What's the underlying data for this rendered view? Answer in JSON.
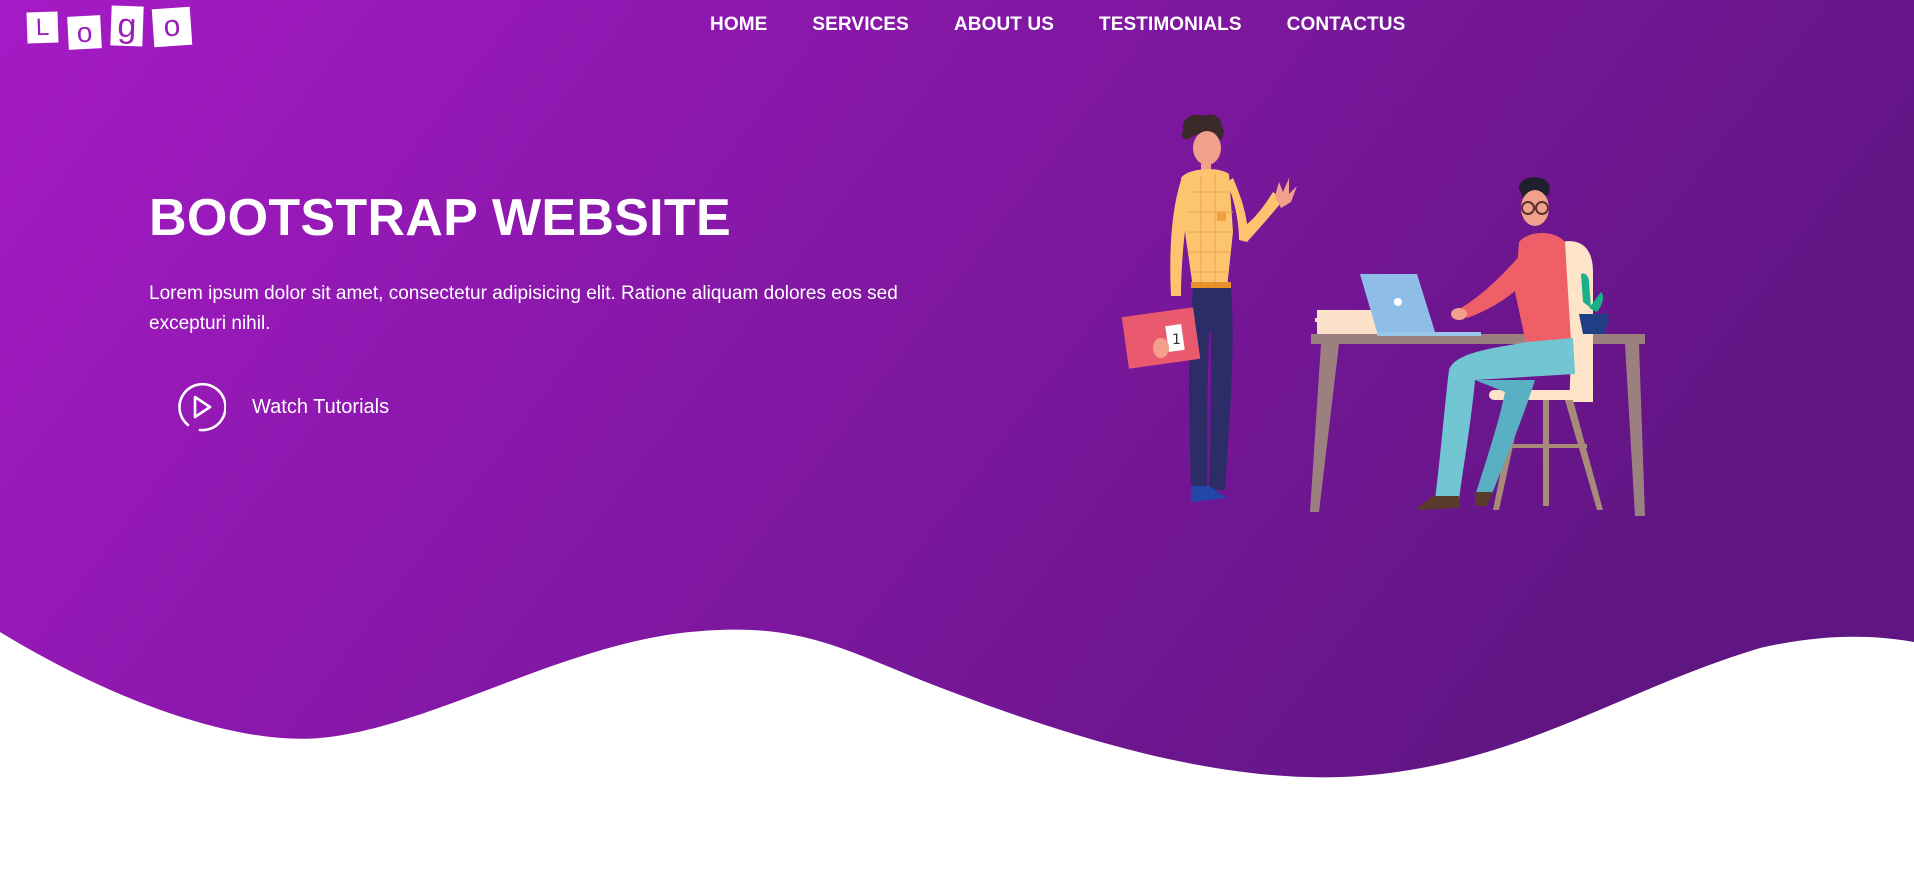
{
  "logo": {
    "letters": [
      "L",
      "o",
      "g",
      "o"
    ]
  },
  "nav": {
    "items": [
      {
        "label": "HOME"
      },
      {
        "label": "SERVICES"
      },
      {
        "label": "ABOUT US"
      },
      {
        "label": "TESTIMONIALS"
      },
      {
        "label": "CONTACTUS"
      }
    ]
  },
  "hero": {
    "title": "BOOTSTRAP WEBSITE",
    "description": "Lorem ipsum dolor sit amet, consectetur adipisicing elit. Ratione aliquam dolores eos sed excepturi nihil.",
    "watch_label": "Watch Tutorials"
  },
  "illustration": {
    "folder_label": "1"
  },
  "colors": {
    "gradient_start": "#a418c4",
    "gradient_end": "#5e1582",
    "text": "#ffffff",
    "below_wave": "#ffffff"
  },
  "icons": {
    "watch": "play-circle-icon"
  }
}
